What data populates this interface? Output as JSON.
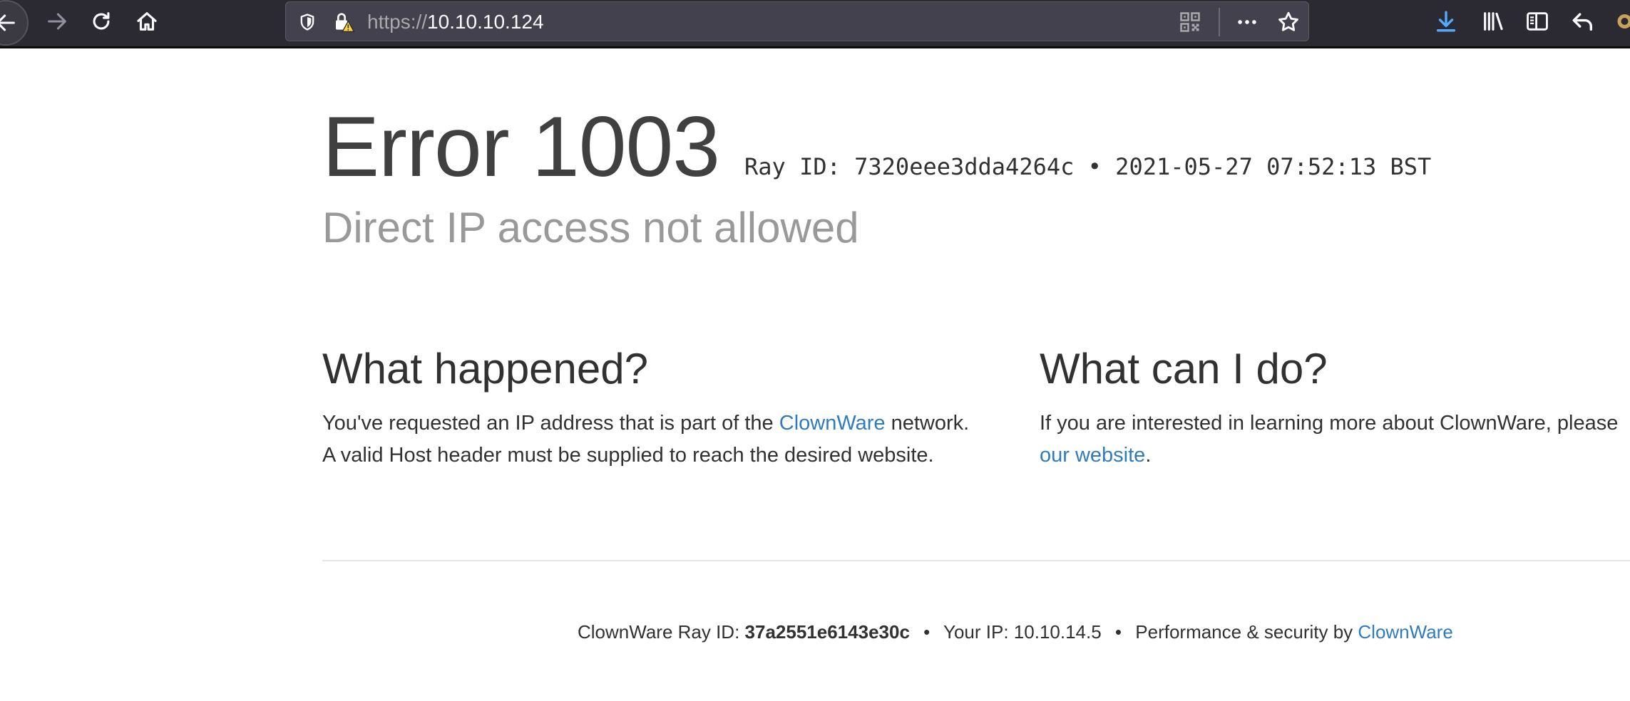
{
  "browser": {
    "url_scheme": "https://",
    "url_host": "10.10.10.124",
    "icons": {
      "back": "arrow-left",
      "forward": "arrow-right",
      "reload": "reload",
      "home": "home",
      "tracking_protection": "shield",
      "site_security": "lock-warning",
      "qr_code": "qr-code",
      "page_actions": "ellipsis",
      "bookmark": "star",
      "downloads": "download-arrow",
      "library": "library",
      "sidebar": "sidebar",
      "share": "undo-arrow"
    },
    "accent_color": "#54a9ff",
    "warning_color": "#ffd43a"
  },
  "error": {
    "title": "Error 1003",
    "ray_label": "Ray ID:",
    "ray_id": "7320eee3dda4264c",
    "bullet": "•",
    "timestamp": "2021-05-27 07:52:13 BST",
    "subtitle": "Direct IP access not allowed"
  },
  "what_happened": {
    "heading": "What happened?",
    "text_before": "You've requested an IP address that is part of the ",
    "link": "ClownWare",
    "text_after": " network. A valid Host header must be supplied to reach the desired website."
  },
  "what_can_i_do": {
    "heading": "What can I do?",
    "text_before": "If you are interested in learning more about ClownWare, please",
    "link": "our website",
    "text_after": "."
  },
  "footer": {
    "ray_label": "ClownWare Ray ID:",
    "ray_id": "37a2551e6143e30c",
    "separator": "•",
    "ip_label": "Your IP:",
    "ip": "10.10.14.5",
    "perf_label": "Performance & security by",
    "perf_link": "ClownWare"
  },
  "colors": {
    "link": "#2f7bbf",
    "subtitle": "#999999",
    "text": "#313131"
  }
}
